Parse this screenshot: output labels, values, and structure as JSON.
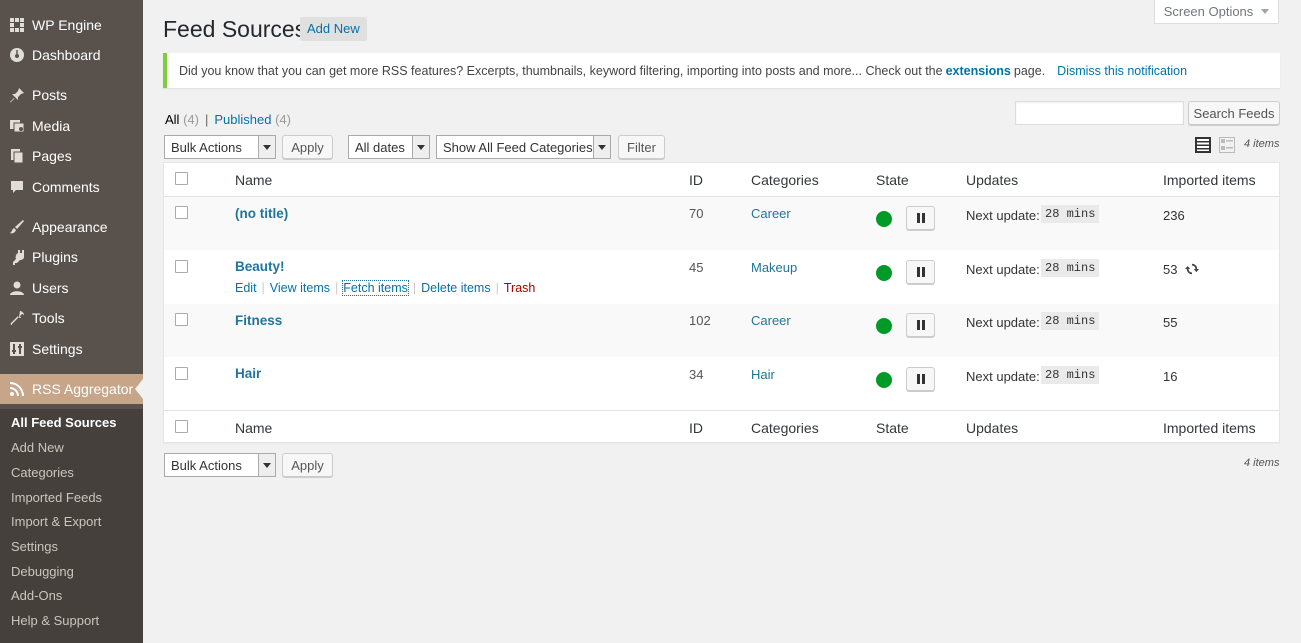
{
  "sidebar": {
    "menu": [
      {
        "label": "WP Engine",
        "icon": "wp-engine-icon"
      },
      {
        "label": "Dashboard",
        "icon": "dashboard-icon"
      },
      {
        "label": "Posts",
        "icon": "pin-icon"
      },
      {
        "label": "Media",
        "icon": "media-icon"
      },
      {
        "label": "Pages",
        "icon": "pages-icon"
      },
      {
        "label": "Comments",
        "icon": "comment-icon"
      },
      {
        "label": "Appearance",
        "icon": "brush-icon"
      },
      {
        "label": "Plugins",
        "icon": "plugin-icon"
      },
      {
        "label": "Users",
        "icon": "user-icon"
      },
      {
        "label": "Tools",
        "icon": "wrench-icon"
      },
      {
        "label": "Settings",
        "icon": "settings-icon"
      },
      {
        "label": "RSS Aggregator",
        "icon": "rss-icon"
      }
    ],
    "submenu": [
      "All Feed Sources",
      "Add New",
      "Categories",
      "Imported Feeds",
      "Import & Export",
      "Settings",
      "Debugging",
      "Add-Ons",
      "Help & Support"
    ]
  },
  "header": {
    "title": "Feed Sources",
    "add_new": "Add New",
    "screen_options": "Screen Options"
  },
  "notice": {
    "text": "Did you know that you can get more RSS features? Excerpts, thumbnails, keyword filtering, importing into posts and more... Check out the",
    "link": "extensions",
    "text_after": "page.",
    "dismiss": "Dismiss this notification"
  },
  "filters": {
    "all_label": "All",
    "all_count": "(4)",
    "separator": "|",
    "published_label": "Published",
    "published_count": "(4)",
    "search_button": "Search Feeds",
    "bulk_actions": "Bulk Actions",
    "apply": "Apply",
    "dates": "All dates",
    "categories": "Show All Feed Categories",
    "filter": "Filter",
    "items_count": "4 items"
  },
  "table": {
    "columns": [
      "Name",
      "ID",
      "Categories",
      "State",
      "Updates",
      "Imported items"
    ],
    "rows": [
      {
        "title": "(no title)",
        "id": "70",
        "category": "Career",
        "update_label": "Next update:",
        "update_value": "28 mins",
        "imported": "236"
      },
      {
        "title": "Beauty!",
        "id": "45",
        "category": "Makeup",
        "update_label": "Next update:",
        "update_value": "28 mins",
        "imported": "53"
      },
      {
        "title": "Fitness",
        "id": "102",
        "category": "Career",
        "update_label": "Next update:",
        "update_value": "28 mins",
        "imported": "55"
      },
      {
        "title": "Hair",
        "id": "34",
        "category": "Hair",
        "update_label": "Next update:",
        "update_value": "28 mins",
        "imported": "16"
      }
    ],
    "row_actions": {
      "edit": "Edit",
      "view": "View items",
      "fetch": "Fetch items",
      "delete": "Delete items",
      "trash": "Trash",
      "sep": "|"
    }
  },
  "colors": {
    "sidebar_bg": "#59524c",
    "active_menu": "#c7a589",
    "state_active": "#009a26",
    "notice_border": "#7ad03a",
    "link": "#0073aa"
  }
}
